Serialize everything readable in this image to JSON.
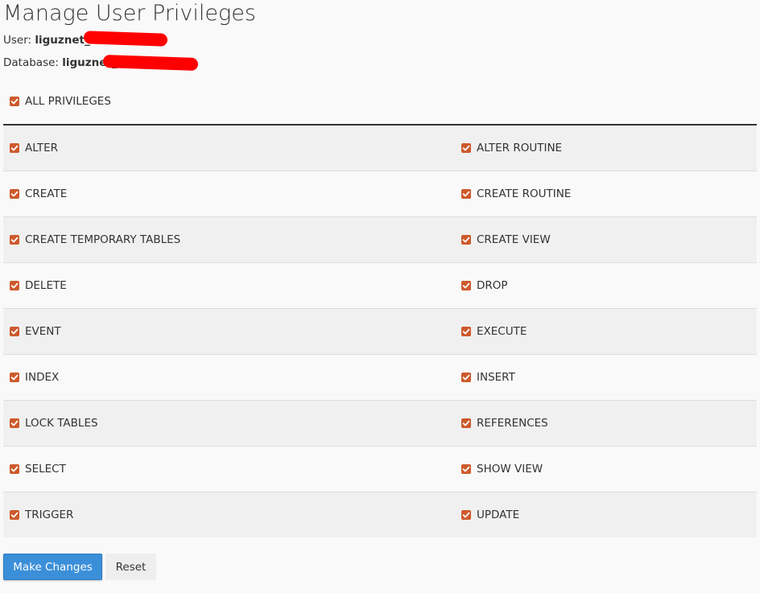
{
  "page": {
    "title": "Manage User Privileges",
    "user_label": "User: ",
    "user_value": "liguznet_",
    "database_label": "Database: ",
    "database_value": "liguznet_",
    "checkbox_color": "#cd5a2c",
    "redaction_color": "#ff0000"
  },
  "all_privileges": {
    "label": "ALL PRIVILEGES",
    "checked": true
  },
  "privileges": [
    {
      "left": "ALTER",
      "right": "ALTER ROUTINE"
    },
    {
      "left": "CREATE",
      "right": "CREATE ROUTINE"
    },
    {
      "left": "CREATE TEMPORARY TABLES",
      "right": "CREATE VIEW"
    },
    {
      "left": "DELETE",
      "right": "DROP"
    },
    {
      "left": "EVENT",
      "right": "EXECUTE"
    },
    {
      "left": "INDEX",
      "right": "INSERT"
    },
    {
      "left": "LOCK TABLES",
      "right": "REFERENCES"
    },
    {
      "left": "SELECT",
      "right": "SHOW VIEW"
    },
    {
      "left": "TRIGGER",
      "right": "UPDATE"
    }
  ],
  "actions": {
    "submit_label": "Make Changes",
    "reset_label": "Reset",
    "submit_color": "#3b8fd8"
  }
}
